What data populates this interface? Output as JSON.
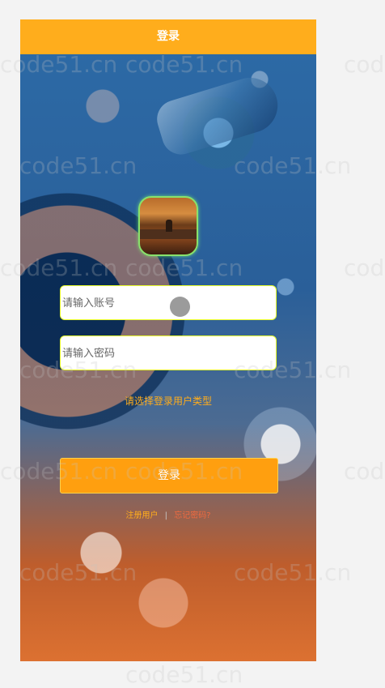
{
  "header": {
    "title": "登录"
  },
  "form": {
    "account_placeholder": "请输入账号",
    "password_placeholder": "请输入密码",
    "user_type_prompt": "请选择登录用户类型",
    "login_label": "登录"
  },
  "links": {
    "register": "注册用户",
    "divider": "|",
    "forgot": "忘记密码?"
  },
  "watermarks": {
    "text": "code51.cn"
  },
  "colors": {
    "header": "#ffad1c",
    "button": "#ff9f0f",
    "input_border": "#eaff27",
    "link": "#ffad1c",
    "forgot": "#ef6a3f"
  }
}
